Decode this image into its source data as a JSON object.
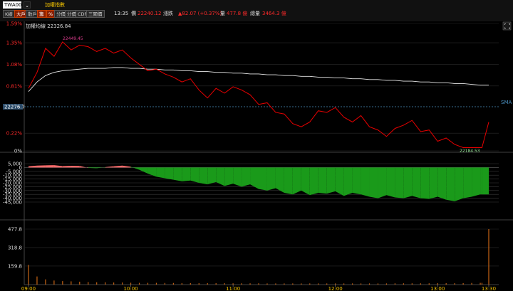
{
  "toolbar": {
    "symbol": "TWA00",
    "symbol_button": "⌄",
    "symbol_name": "加權指數",
    "buttons": [
      {
        "label": "K線",
        "active": false
      },
      {
        "label": "大戶",
        "active": true
      },
      {
        "label": "散戶",
        "active": false
      },
      {
        "label": "籌",
        "active": true
      },
      {
        "label": "%",
        "active": true
      },
      {
        "label": "分價",
        "active": false
      },
      {
        "label": "分價",
        "active": false
      },
      {
        "label": "CDP",
        "active": false
      },
      {
        "label": "三關價",
        "active": false
      }
    ],
    "time": "13:35",
    "price_label": "價",
    "price": "22240.12",
    "change_label": "漲跌",
    "change": "▲82.07 (+0.37%)",
    "volume_label": "量",
    "volume": "477.8 億",
    "total_label": "總量",
    "total": "3464.3 億"
  },
  "main_panel": {
    "legend": "加權均線 22326.84",
    "high_label": "22449.45",
    "low_label": "22184.53",
    "sma_label": "SMA",
    "ref_value": "22276.7",
    "expand_icon": "expand-icon"
  },
  "colors": {
    "price_line": "#e60000",
    "avg_line": "#e8e8e8",
    "bull": "#ff6b6b",
    "bear": "#1a9a1a",
    "volume": "#c86414",
    "ref_line": "#4a90c0"
  },
  "chart_data": {
    "type": "line",
    "price_axis_ticks": [
      "1.59%",
      "1.35%",
      "1.08%",
      "0.81%",
      "0.22%",
      "0%"
    ],
    "net_axis_ticks": [
      "5,000",
      "0",
      "-5,000",
      "-10,000",
      "-15,000",
      "-20,000",
      "-25,000",
      "-30,000",
      "-35,000",
      "-40,000",
      "-45,000"
    ],
    "volume_axis_ticks": [
      "477.8",
      "318.8",
      "159.8"
    ],
    "time_ticks": [
      "09:00",
      "10:00",
      "11:00",
      "12:00",
      "13:00",
      "13:30"
    ],
    "x_minutes": [
      0,
      5,
      10,
      15,
      20,
      25,
      30,
      35,
      40,
      45,
      50,
      55,
      60,
      65,
      70,
      75,
      80,
      85,
      90,
      95,
      100,
      105,
      110,
      115,
      120,
      125,
      130,
      135,
      140,
      145,
      150,
      155,
      160,
      165,
      170,
      175,
      180,
      185,
      190,
      195,
      200,
      205,
      210,
      215,
      220,
      225,
      230,
      235,
      240,
      245,
      250,
      255,
      260,
      265,
      266,
      270
    ],
    "price_pct": [
      0.78,
      0.98,
      1.28,
      1.18,
      1.36,
      1.26,
      1.32,
      1.3,
      1.24,
      1.28,
      1.22,
      1.26,
      1.16,
      1.08,
      1.0,
      1.02,
      0.96,
      0.92,
      0.86,
      0.9,
      0.76,
      0.66,
      0.78,
      0.72,
      0.8,
      0.76,
      0.7,
      0.58,
      0.6,
      0.48,
      0.46,
      0.34,
      0.3,
      0.36,
      0.5,
      0.48,
      0.54,
      0.42,
      0.36,
      0.44,
      0.3,
      0.26,
      0.18,
      0.28,
      0.32,
      0.38,
      0.24,
      0.26,
      0.12,
      0.16,
      0.08,
      0.04,
      0.04,
      0.04,
      0.04,
      0.36
    ],
    "avg_pct": [
      0.74,
      0.86,
      0.94,
      0.98,
      1.0,
      1.01,
      1.02,
      1.03,
      1.03,
      1.03,
      1.04,
      1.04,
      1.03,
      1.03,
      1.02,
      1.02,
      1.01,
      1.01,
      1.0,
      1.0,
      0.99,
      0.99,
      0.98,
      0.98,
      0.97,
      0.97,
      0.96,
      0.96,
      0.95,
      0.95,
      0.94,
      0.94,
      0.93,
      0.93,
      0.92,
      0.92,
      0.91,
      0.91,
      0.9,
      0.9,
      0.89,
      0.89,
      0.88,
      0.88,
      0.87,
      0.87,
      0.86,
      0.86,
      0.85,
      0.85,
      0.84,
      0.84,
      0.83,
      0.82,
      0.82,
      0.82
    ],
    "net": [
      1500,
      2500,
      2800,
      3000,
      1800,
      2200,
      2000,
      -500,
      -1000,
      500,
      1500,
      2500,
      1000,
      -3000,
      -8000,
      -12000,
      -14000,
      -16000,
      -18000,
      -17000,
      -20000,
      -22000,
      -19000,
      -24000,
      -21000,
      -25000,
      -22000,
      -28000,
      -30000,
      -27000,
      -33000,
      -35000,
      -30000,
      -36000,
      -33000,
      -34000,
      -31000,
      -37000,
      -33000,
      -35000,
      -38000,
      -40000,
      -36000,
      -39000,
      -40000,
      -37000,
      -40000,
      -41000,
      -38000,
      -42000,
      -44000,
      -40000,
      -38000,
      -35000,
      -35000,
      -35000
    ],
    "volume": [
      170,
      70,
      45,
      35,
      30,
      28,
      25,
      22,
      20,
      20,
      18,
      18,
      16,
      15,
      15,
      15,
      14,
      14,
      13,
      13,
      12,
      12,
      12,
      12,
      11,
      11,
      11,
      11,
      10,
      10,
      10,
      10,
      10,
      10,
      10,
      10,
      10,
      10,
      10,
      10,
      10,
      10,
      10,
      11,
      11,
      11,
      11,
      11,
      12,
      12,
      12,
      13,
      14,
      15,
      15,
      477.8
    ]
  }
}
